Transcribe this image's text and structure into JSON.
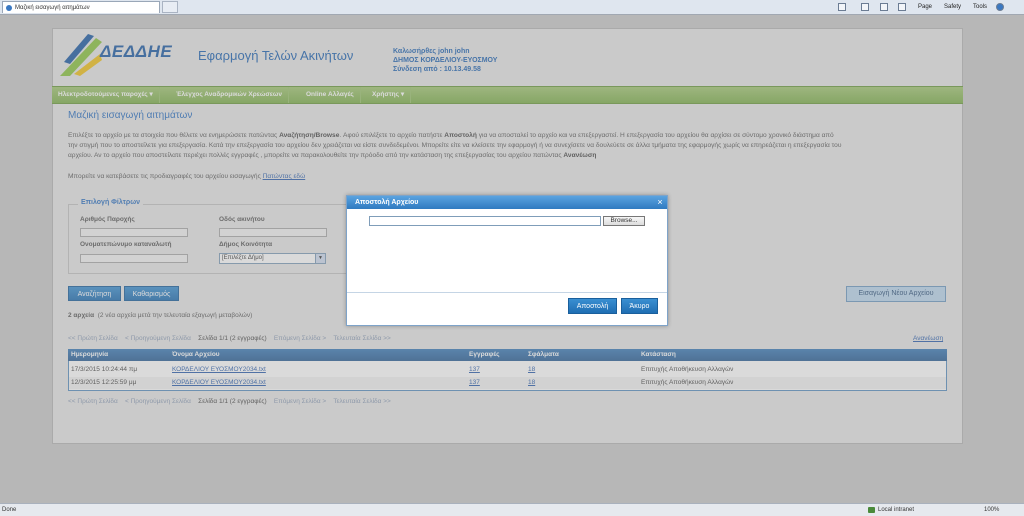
{
  "browser": {
    "tab_title": "Μαζική εισαγωγή αιτημάτων",
    "commands": [
      "Page",
      "Safety",
      "Tools"
    ],
    "status_left": "Done",
    "zone": "Local intranet",
    "zoom": "100%"
  },
  "header": {
    "logo_text": "ΔΕΔΔΗΕ",
    "app_title": "Εφαρμογή Τελών Ακινήτων",
    "greeting": "Καλωσήρθες john john",
    "municipality": "ΔΗΜΟΣ ΚΟΡΔΕΛΙΟΥ-ΕΥΟΣΜΟΥ",
    "login": "Σύνδεση από : 10.13.49.58"
  },
  "nav": {
    "items": [
      "Ηλεκτροδοτούμενες παροχές ▾",
      "Έλεγχος Αναδρομικών Χρεώσεων",
      "Online Αλλαγές",
      "Χρήστης ▾"
    ]
  },
  "main": {
    "title": "Μαζική εισαγωγή αιτημάτων",
    "para1_a": "Επιλέξτε το αρχείο με τα στοιχεία που θέλετε να ενημερώσετε πατώντας ",
    "para1_b": "Αναζήτηση/Browse",
    "para1_c": ". Αφού επιλέξετε το αρχείο πατήστε ",
    "para1_d": "Αποστολή",
    "para1_e": " για να αποσταλεί το αρχείο και να επεξεργαστεί. Η επεξεργασία του αρχείου θα αρχίσει σε σύντομο χρονικό διάστημα από",
    "para1_line2": "την στιγμή που το αποστείλετε για επεξεργασία. Κατά την επεξεργασία του αρχείου δεν χρειάζεται να είστε συνδεδεμένοι. Μπορείτε είτε να κλείσετε την εφαρμογή ή να συνεχίσετε να δουλεύετε σε άλλα τμήματα της εφαρμογής χωρίς να επηρεάζεται η επεξεργασία του",
    "para1_line3_a": "αρχείου. Αν το αρχείο που αποστείλατε περιέχει πολλές εγγραφές , μπορείτε να παρακολουθείτε την πρόοδο από την κατάσταση της επεξεργασίας του αρχείου πατώντας ",
    "para1_line3_b": "Ανανέωση",
    "para2_a": "Μπορείτε να κατεβάσετε τις προδιαγραφές του αρχείου εισαγωγής ",
    "para2_link": "Πατώντας εδώ"
  },
  "filters": {
    "legend": "Επιλογή Φίλτρων",
    "supply_label": "Αριθμός Παροχής",
    "street_label": "Οδός ακινήτου",
    "consumer_label": "Ονοματεπώνυμο καταναλωτή",
    "municipality_label": "Δήμος Κοινότητα",
    "municipality_value": "[Επιλέξτε Δήμο]"
  },
  "buttons": {
    "search": "Αναζήτηση",
    "clear": "Καθαρισμός",
    "import_new": "Εισαγωγή Νέου Αρχείου"
  },
  "results": {
    "count_bold": "2 αρχεία",
    "count_rest": "(2 νέα αρχεία μετά την τελευταία εξαγωγή μεταβολών)",
    "refresh": "Ανανέωση",
    "pager": {
      "first": "<< Πρώτη Σελίδα",
      "prev": "< Προηγούμενη Σελίδα",
      "current": "Σελίδα 1/1 (2 εγγραφές)",
      "next": "Επόμενη Σελίδα >",
      "last": "Τελευταία Σελίδα >>"
    },
    "columns": [
      "Ημερομηνία",
      "Όνομα Αρχείου",
      "Εγγραφές",
      "Σφάλματα",
      "Κατάσταση"
    ],
    "rows": [
      {
        "date": "17/3/2015 10:24:44 πμ",
        "file": "ΚΟΡΔΕΛΙΟΥ ΕΥΟΣΜΟΥ2034.txt",
        "records": "137",
        "errors": "18",
        "status": "Επιτυχής Αποθήκευση Αλλαγών"
      },
      {
        "date": "12/3/2015 12:25:59 μμ",
        "file": "ΚΟΡΔΕΛΙΟΥ ΕΥΟΣΜΟΥ2034.txt",
        "records": "137",
        "errors": "18",
        "status": "Επιτυχής Αποθήκευση Αλλαγών"
      }
    ]
  },
  "dialog": {
    "title": "Αποστολή Αρχείου",
    "close": "×",
    "browse": "Browse...",
    "send": "Αποστολή",
    "cancel": "Άκυρο"
  }
}
